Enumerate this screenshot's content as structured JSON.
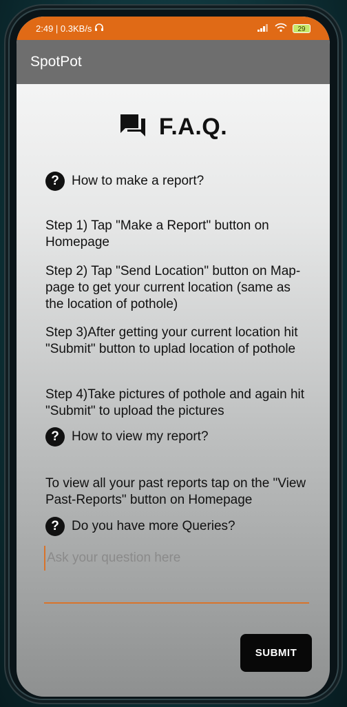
{
  "status_bar": {
    "time_speed": "2:49 | 0.3KB/s",
    "battery": "29"
  },
  "app_bar": {
    "title": "SpotPot"
  },
  "faq": {
    "title": "F.A.Q.",
    "q1": "How to make a report?",
    "step1": "Step 1) Tap \"Make a Report\" button on Homepage",
    "step2": "Step 2) Tap \"Send Location\" button on Map-page to get your current location (same as the location of pothole)",
    "step3": "Step 3)After getting your current location hit \"Submit\" button to uplad location of pothole",
    "step4": "Step 4)Take pictures of pothole and again hit \"Submit\" to upload the pictures",
    "q2": "How to view my report?",
    "answer2": "To view all your past reports tap on the \"View Past-Reports\" button on Homepage",
    "q3": "Do you have more Queries?"
  },
  "question_input": {
    "placeholder": "Ask your question here",
    "value": ""
  },
  "submit_label": "SUBMIT",
  "colors": {
    "status_bar": "#e06a16",
    "app_bar": "#6e6e6e",
    "accent": "#d9732a",
    "button": "#080808"
  },
  "icons": {
    "title_icon": "forum-icon",
    "question_icon": "help-circle-icon",
    "headphones": "headphones-icon",
    "signal": "signal-icon",
    "wifi": "wifi-icon",
    "battery": "battery-icon"
  }
}
